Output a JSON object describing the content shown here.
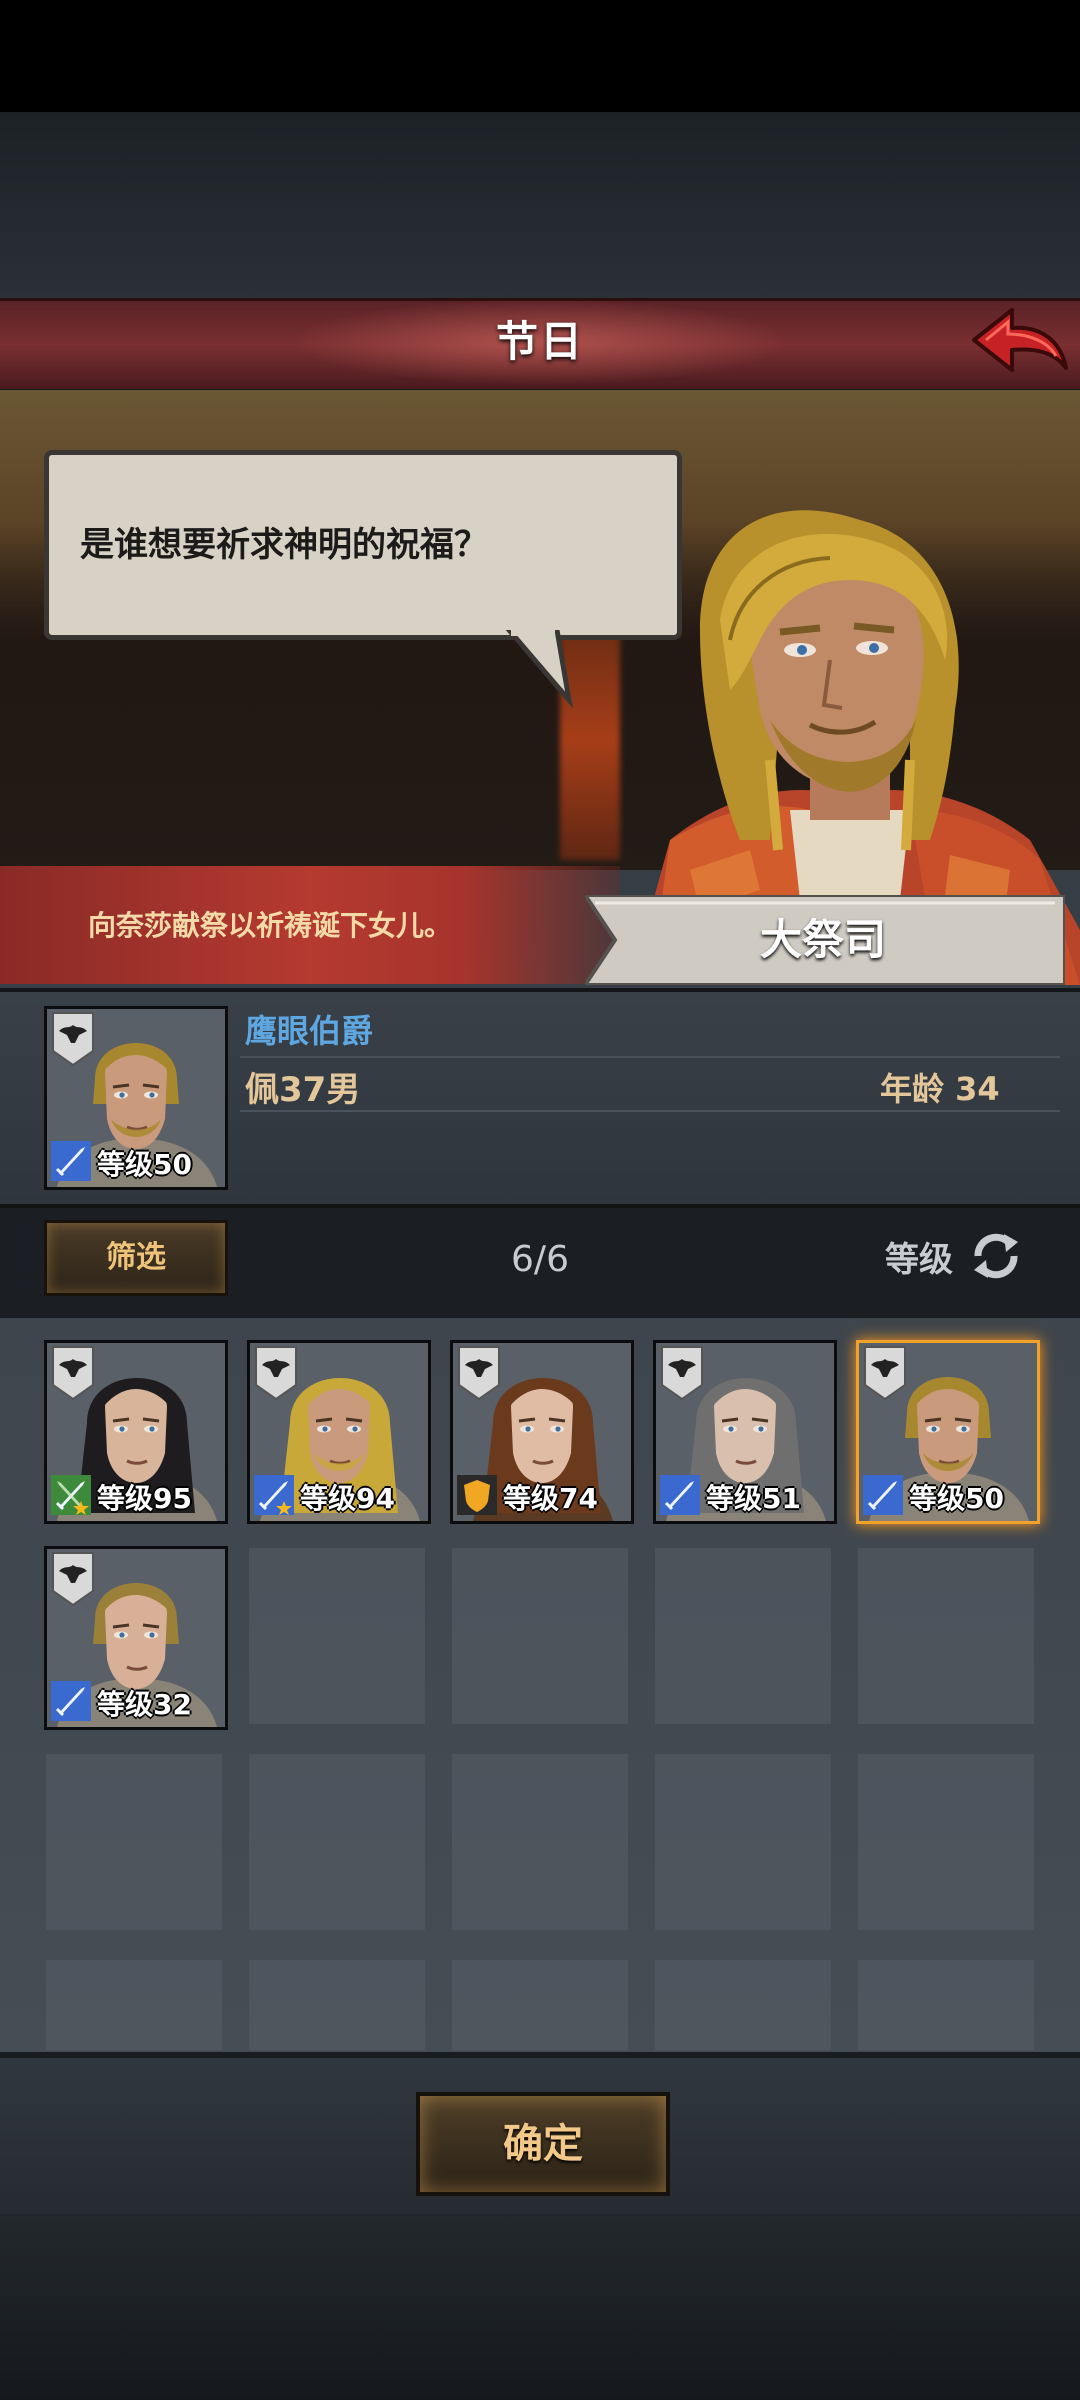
{
  "header": {
    "title": "节日"
  },
  "scene": {
    "speech": "是谁想要祈求神明的祝福？",
    "description": "向奈莎献祭以祈祷诞下女儿。",
    "npc_name": "大祭司"
  },
  "selected_character": {
    "name": "鹰眼伯爵",
    "subtitle": "佩37男",
    "age": "年龄 34",
    "level": "等级50"
  },
  "filter_bar": {
    "filter_label": "筛选",
    "count": "6/6",
    "sort_label": "等级"
  },
  "characters": [
    {
      "level": "等级95",
      "hair": "black-long",
      "class": "dual-sword",
      "colors": {
        "skin": "#d8b49a",
        "hair": "#1e1c1e"
      }
    },
    {
      "level": "等级94",
      "hair": "blonde-long",
      "class": "sword-star",
      "colors": {
        "skin": "#c99a7c",
        "hair": "#c9a83a"
      }
    },
    {
      "level": "等级74",
      "hair": "brown-long",
      "class": "shield",
      "colors": {
        "skin": "#e0bca4",
        "hair": "#6b3a1c"
      }
    },
    {
      "level": "等级51",
      "hair": "grey-long",
      "class": "sword",
      "colors": {
        "skin": "#d9c0ae",
        "hair": "#6f6f6f"
      }
    },
    {
      "level": "等级50",
      "hair": "blonde-short",
      "class": "sword",
      "selected": true,
      "colors": {
        "skin": "#c99a7c",
        "hair": "#a8882e"
      }
    },
    {
      "level": "等级32",
      "hair": "blonde-short",
      "class": "sword",
      "colors": {
        "skin": "#d8b098",
        "hair": "#9a8038"
      }
    }
  ],
  "footer": {
    "confirm_label": "确定"
  },
  "colors": {
    "title_bar": "#7a2f31",
    "accent_gold": "#f0c37a",
    "name_blue": "#5fa7e0",
    "selected_border": "#f0a22a"
  }
}
